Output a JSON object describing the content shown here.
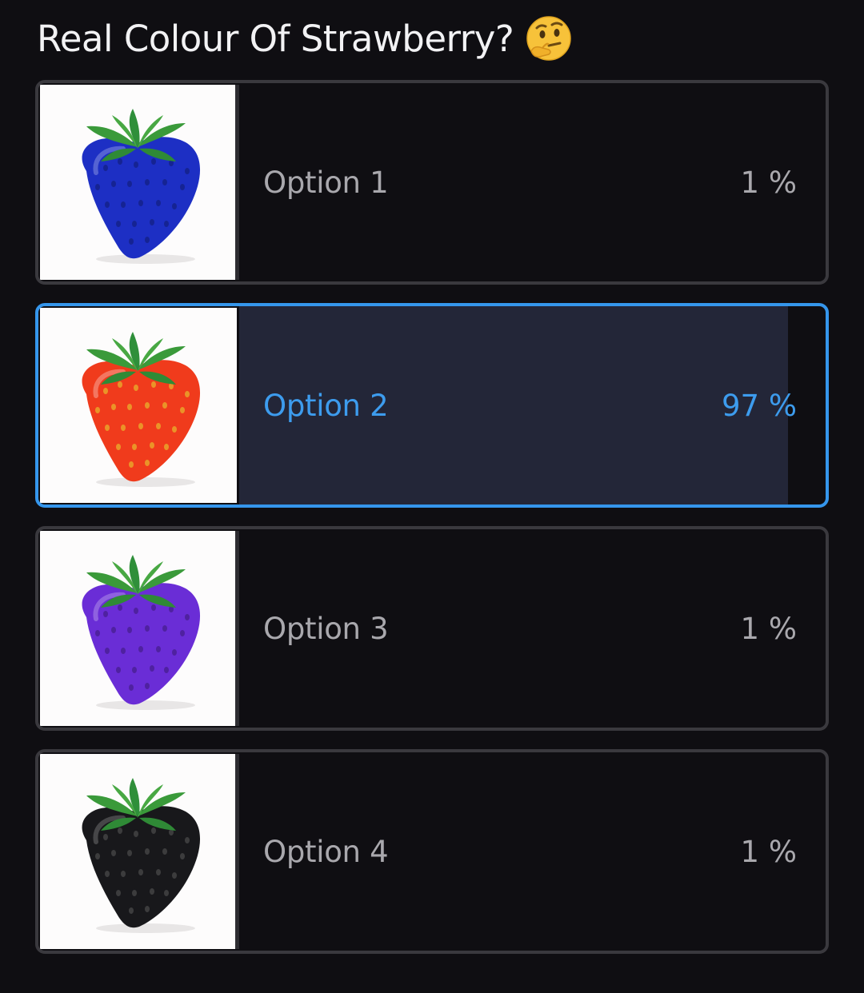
{
  "poll": {
    "question": "Real Colour Of Strawberry?",
    "question_emoji": "thinking-face-icon",
    "accent_color": "#3596ec",
    "options": [
      {
        "label": "Option 1",
        "percent_text": "1 %",
        "percent": 1,
        "selected": false,
        "image": "blue-strawberry",
        "fruit_color": "#1d2fc4"
      },
      {
        "label": "Option 2",
        "percent_text": "97 %",
        "percent": 97,
        "selected": true,
        "image": "red-strawberry",
        "fruit_color": "#f03b1c"
      },
      {
        "label": "Option 3",
        "percent_text": "1 %",
        "percent": 1,
        "selected": false,
        "image": "purple-strawberry",
        "fruit_color": "#6a2dd6"
      },
      {
        "label": "Option 4",
        "percent_text": "1 %",
        "percent": 1,
        "selected": false,
        "image": "black-strawberry",
        "fruit_color": "#18181b"
      }
    ]
  }
}
